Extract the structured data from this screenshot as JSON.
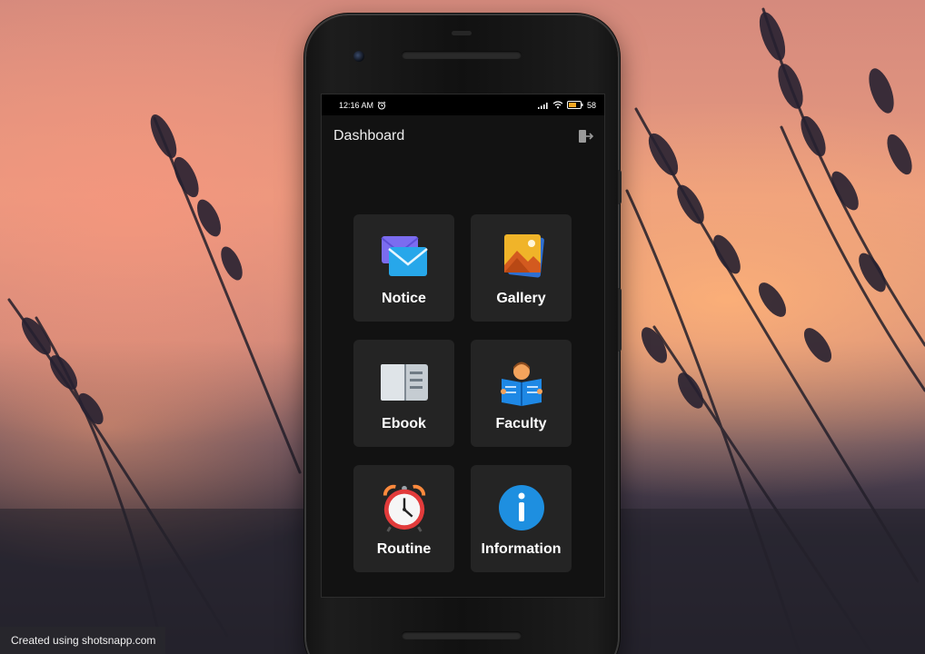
{
  "status_bar": {
    "time": "12:16 AM",
    "battery": "58"
  },
  "app_bar": {
    "title": "Dashboard",
    "logout_icon": "logout-icon"
  },
  "tiles": [
    {
      "label": "Notice",
      "icon": "mail-icon"
    },
    {
      "label": "Gallery",
      "icon": "photos-icon"
    },
    {
      "label": "Ebook",
      "icon": "book-icon"
    },
    {
      "label": "Faculty",
      "icon": "reader-icon"
    },
    {
      "label": "Routine",
      "icon": "alarm-clock-icon"
    },
    {
      "label": "Information",
      "icon": "info-icon"
    }
  ],
  "watermark": {
    "text": "Created using shotsnapp.com"
  },
  "colors": {
    "screen_bg": "#121212",
    "tile_bg": "#242424",
    "battery": "#f5a623"
  }
}
